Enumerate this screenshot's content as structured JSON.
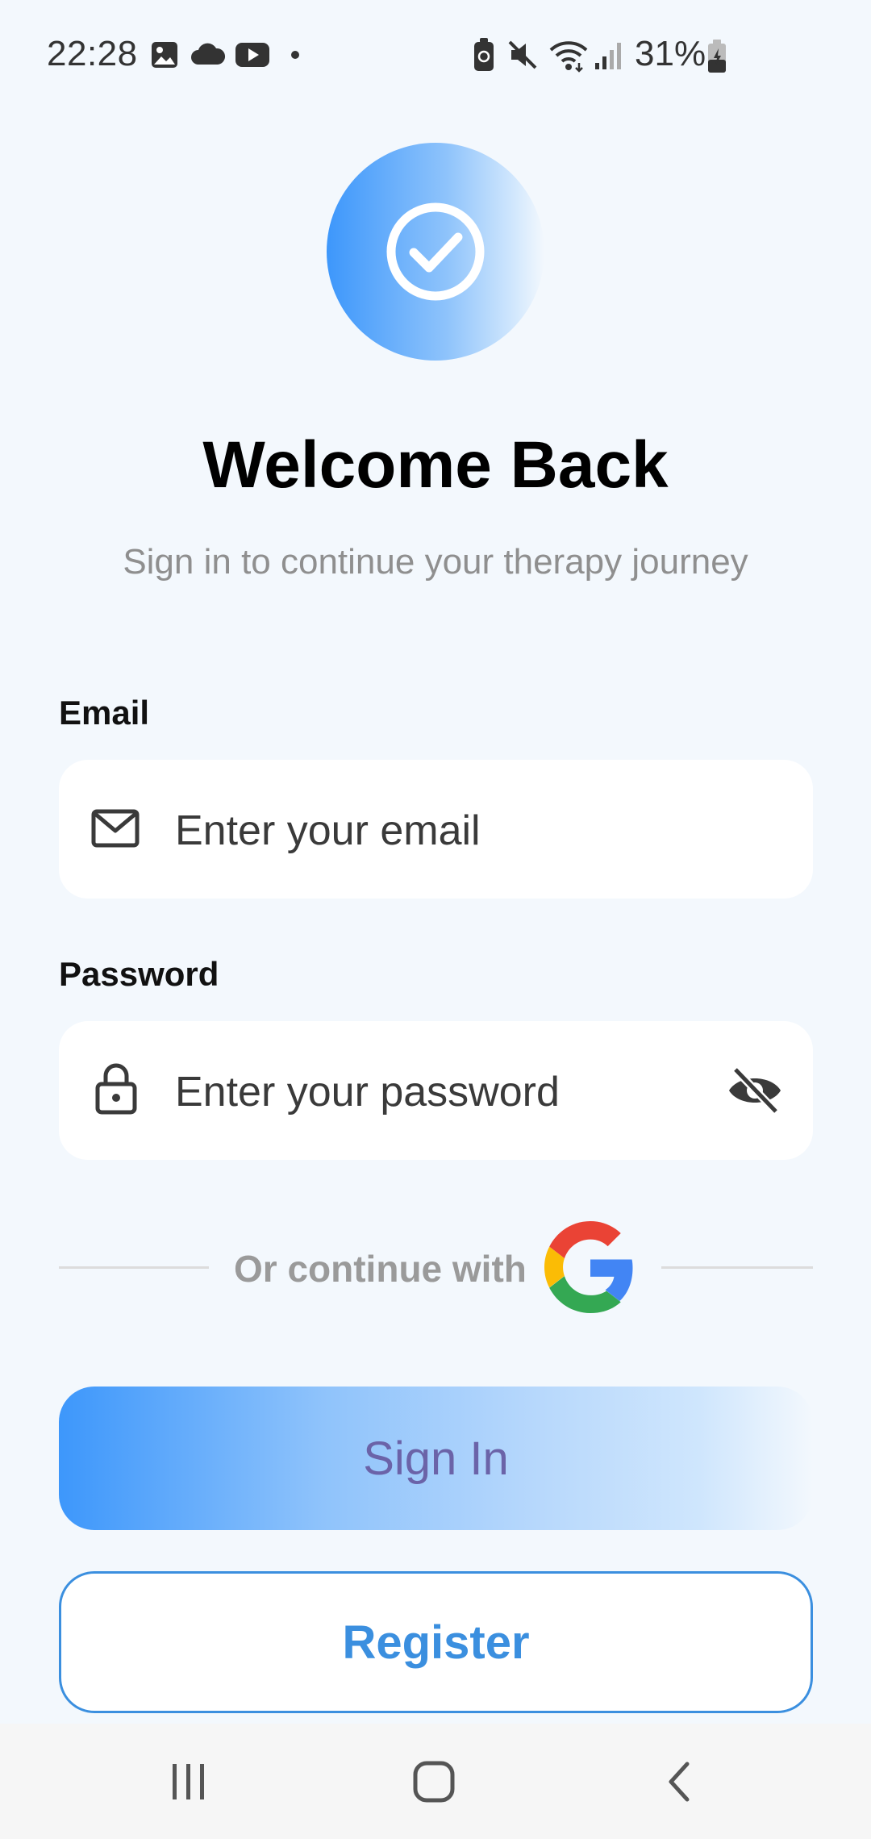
{
  "status_bar": {
    "time": "22:28",
    "battery_percent": "31%",
    "left_icons": [
      "gallery-icon",
      "cloud-icon",
      "youtube-icon",
      "dot-icon"
    ],
    "right_icons": [
      "battery-saver-icon",
      "mute-icon",
      "wifi-icon",
      "signal-icon",
      "battery-charging-icon"
    ]
  },
  "header": {
    "title": "Welcome Back",
    "subtitle": "Sign in to continue your therapy journey"
  },
  "form": {
    "email_label": "Email",
    "email_placeholder": "Enter your email",
    "password_label": "Password",
    "password_placeholder": "Enter your password"
  },
  "social": {
    "divider_text": "Or continue with"
  },
  "actions": {
    "sign_in_label": "Sign In",
    "register_label": "Register"
  },
  "colors": {
    "background": "#f3f8fd",
    "accent_blue": "#3d97fb",
    "register_blue": "#3b8fdf",
    "sign_in_text": "#6b63a8"
  }
}
